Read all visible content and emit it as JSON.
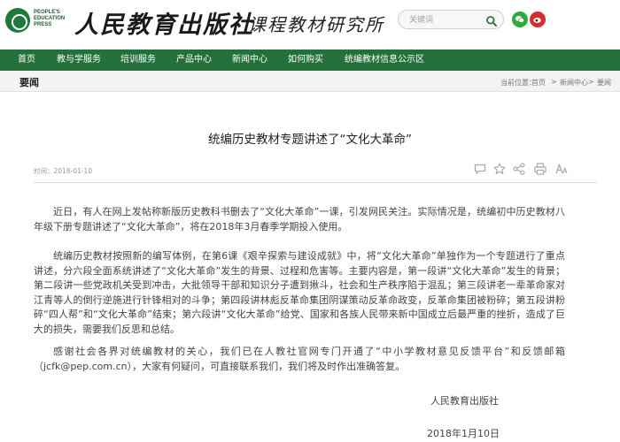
{
  "header": {
    "logo_lines": [
      "PEOPLE'S",
      "EDUCATION",
      "PRESS"
    ],
    "brand_cn": "人民教育出版社",
    "brand_sub": "课程教材研究所",
    "search_placeholder": "关键词"
  },
  "nav": {
    "items": [
      "首页",
      "教与学服务",
      "培训服务",
      "产品中心",
      "新闻中心",
      "如何购买",
      "统编教材信息公示区"
    ]
  },
  "section": {
    "title": "要闻",
    "breadcrumb_prefix": "当前位置：",
    "breadcrumb": [
      "首页",
      "新闻中心",
      "要闻"
    ],
    "separator": ">"
  },
  "article": {
    "title": "统编历史教材专题讲述了“文化大革命”",
    "time": "时间：2018-01-10",
    "paragraphs": [
      "近日，有人在网上发帖称新版历史教科书删去了“文化大革命”一课，引发网民关注。实际情况是，统编初中历史教材八年级下册专题讲述了“文化大革命”，将在2018年3月春季学期投入使用。",
      "统编历史教材按照新的编写体例，在第6课《艰辛探索与建设成就》中，将“文化大革命”单独作为一个专题进行了重点讲述，分六段全面系统讲述了“文化大革命”发生的背景、过程和危害等。主要内容是，第一段讲“文化大革命”发生的背景；第二段讲一些党政机关受到冲击，大批领导干部和知识分子遭到揪斗，社会和生产秩序陷于混乱；第三段讲老一辈革命家对江青等人的倒行逆施进行针锋相对的斗争；第四段讲林彪反革命集团阴谋策动反革命政变，反革命集团被粉碎；第五段讲粉碎“四人帮”和“文化大革命”结束；第六段讲“文化大革命”给党、国家和各族人民带来新中国成立后最严重的挫折，造成了巨大的损失，需要我们反思和总结。",
      "感谢社会各界对统编教材的关心，我们已在人教社官网专门开通了“中小学教材意见反馈平台”和反馈邮箱（jcfk@pep.com.cn），大家有何疑问，可直接联系我们，我们将及时作出准确答复。"
    ],
    "signature": "人民教育出版社",
    "date": "2018年1月10日"
  },
  "icons": {
    "search": "search-icon",
    "wechat": "wechat-icon",
    "weibo": "weibo-icon",
    "tools": [
      "comment-icon",
      "favorite-icon",
      "share-icon",
      "print-icon",
      "font-size-icon"
    ]
  },
  "colors": {
    "nav_bg": "#24703a",
    "logo_green": "#1e7a3a",
    "wechat": "#2aad3a",
    "weibo": "#d92b2b"
  }
}
